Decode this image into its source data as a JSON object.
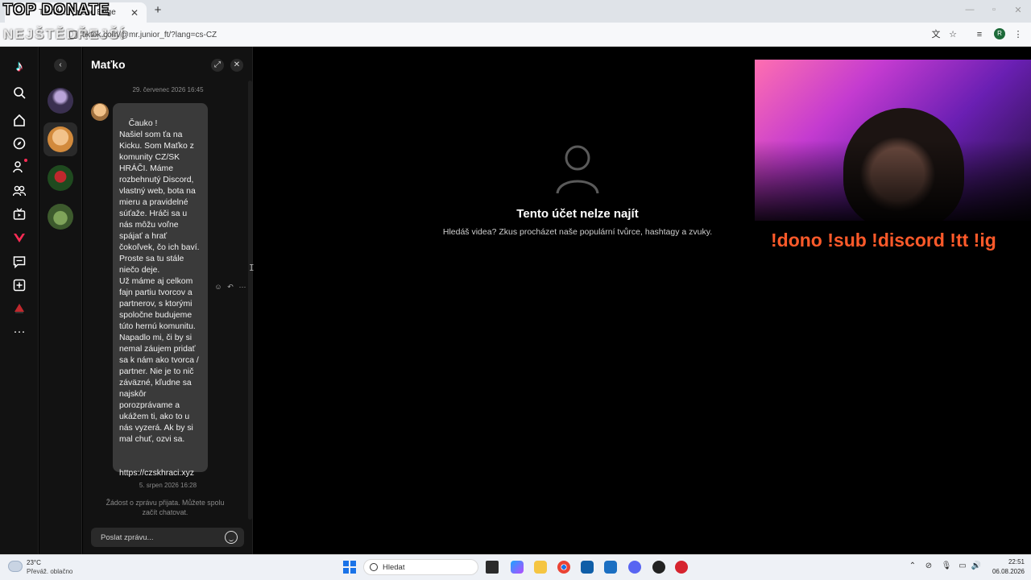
{
  "overlay": {
    "top_text": "TOP DONATE",
    "sub_text": "NEJŠTĚDŘEJŠÍ"
  },
  "browser": {
    "tab_title": "TikTok ... jmeno Enge",
    "new_tab_icon": "plus-icon",
    "url": "tiktok.com/@mr.junior_ft/?lang=cs-CZ",
    "window_controls": [
      "minimize-icon",
      "maximize-icon",
      "close-icon"
    ],
    "toolbar_icons": [
      "translate-icon",
      "star-icon",
      "playlist-icon",
      "profile-icon",
      "menu-icon"
    ],
    "profile_initial": "R"
  },
  "nav_rail": {
    "items": [
      "tiktok-logo-icon",
      "search-icon",
      "home-icon",
      "explore-icon",
      "following-icon",
      "friends-icon",
      "live-icon",
      "shop-icon",
      "messages-icon",
      "upload-icon",
      "melon-icon",
      "more-icon"
    ]
  },
  "chat": {
    "title": "Maťko",
    "timestamp_1": "29. červenec 2026 16:45",
    "message": "Čauko !\nNašiel som ťa na Kicku. Som Maťko z komunity CZ/SK HRÁČI. Máme rozbehnutý Discord, vlastný web, bota na mieru a pravidelné súťaže. Hráči sa u nás môžu voľne spájať a hrať čokoľvek, čo ich baví. Proste sa tu stále niečo deje.\nUž máme aj celkom fajn partiu tvorcov a partnerov, s ktorými spoločne budujeme túto hernú komunitu.\nNapadlo mi, či by si nemal záujem pridať sa k nám ako tvorca / partner. Nie je to nič záväzné, kľudne sa najskôr porozprávame a ukážem ti, ako to u nás vyzerá. Ak by si mal chuť, ozvi sa.",
    "link": "https://czskhraci.xyz",
    "timestamp_2": "5. srpen 2026 16:28",
    "system_message": "Žádost o zprávu přijata. Můžete spolu začít chatovat.",
    "composer_placeholder": "Poslat zprávu..."
  },
  "main": {
    "empty_title": "Tento účet nelze najít",
    "empty_subtitle": "Hledáš videa? Zkus procházet naše populární tvůrce, hashtagy a zvuky."
  },
  "stream": {
    "commands": "!dono !sub !discord !tt !ig"
  },
  "taskbar": {
    "temperature": "23°C",
    "weather": "Převáž. oblačno",
    "search_label": "Hledat",
    "time": "22:51",
    "date": "06.08.2026",
    "colors": {
      "accent": "#1a73e8",
      "tiktok_red": "#fe2c55",
      "stream_orange": "#ff5a2a"
    }
  }
}
